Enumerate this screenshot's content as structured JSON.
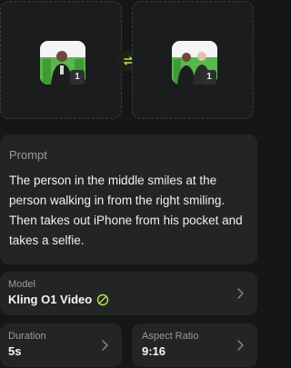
{
  "reference_images": [
    {
      "badge": "1"
    },
    {
      "badge": "1"
    }
  ],
  "prompt": {
    "label": "Prompt",
    "text": "The person in the middle smiles at the person walking in from the right smiling. Then takes out iPhone from his pocket and takes a selfie."
  },
  "model": {
    "label": "Model",
    "value": "Kling O1 Video",
    "accent": "#b7e34a"
  },
  "duration": {
    "label": "Duration",
    "value": "5s"
  },
  "aspect_ratio": {
    "label": "Aspect Ratio",
    "value": "9:16"
  },
  "colors": {
    "background": "#151617",
    "card": "#232426",
    "accent": "#b7e34a"
  }
}
